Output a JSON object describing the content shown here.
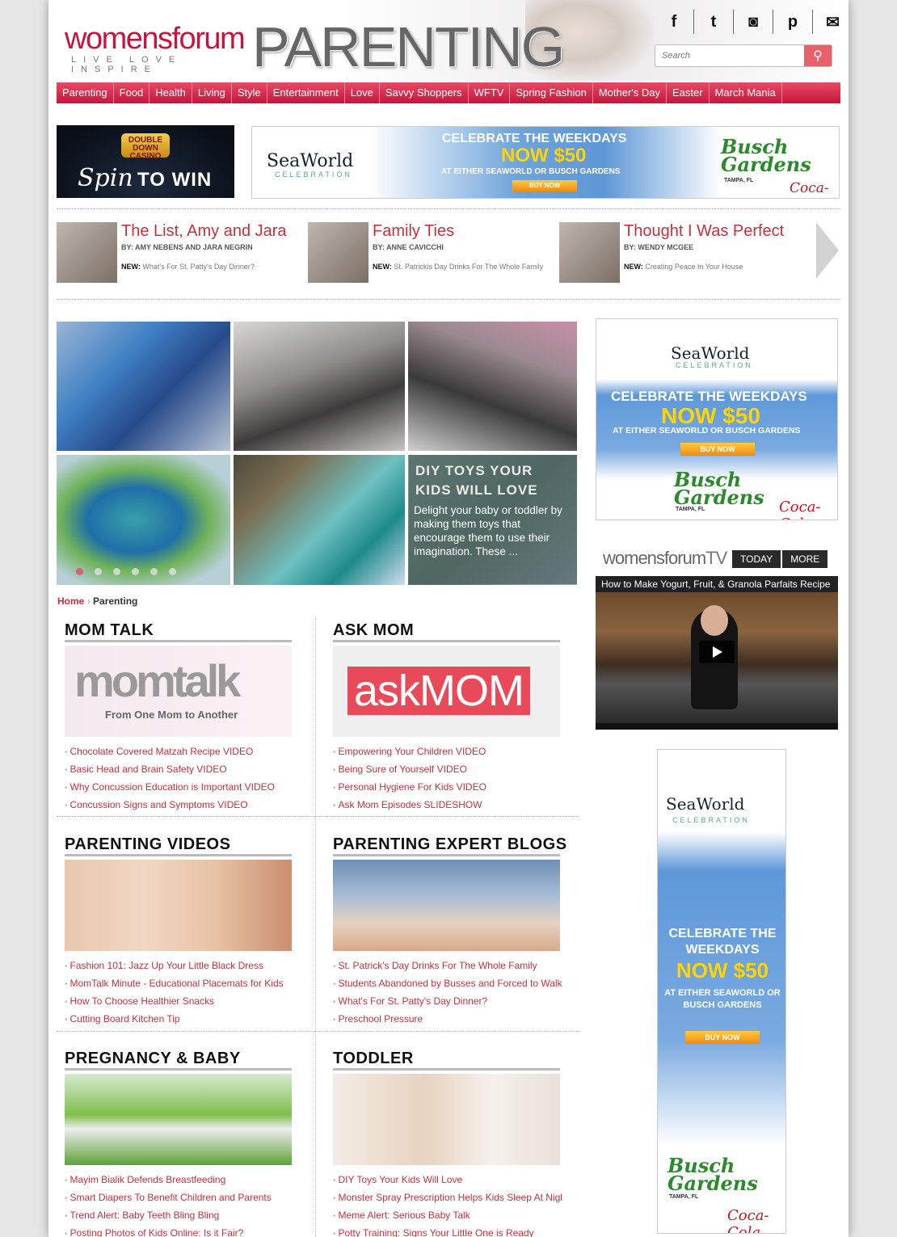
{
  "header": {
    "logo_main": "womensforum",
    "logo_tagline": "LIVE LOVE INSPIRE",
    "brand": "PARENTING",
    "social": [
      "f",
      "t",
      "◙",
      "p",
      "✉"
    ],
    "social_icons": [
      "facebook-icon",
      "twitter-icon",
      "instagram-icon",
      "pinterest-icon",
      "email-icon"
    ],
    "search_placeholder": "Search"
  },
  "nav": [
    "Parenting",
    "Food",
    "Health",
    "Living",
    "Style",
    "Entertainment",
    "Love",
    "Savvy Shoppers",
    "WFTV",
    "Spring Fashion",
    "Mother's Day",
    "Easter",
    "March Mania"
  ],
  "ads": {
    "spin": {
      "badge": "DOUBLE DOWN CASINO",
      "spin": "Spin",
      "towin": "TO WIN"
    },
    "seaworld": {
      "brand": "SeaWorld",
      "celebration": "CELEBRATION",
      "line1": "CELEBRATE THE WEEKDAYS",
      "line2": "NOW $50",
      "line3": "AT EITHER SEAWORLD OR BUSCH GARDENS",
      "buy": "BUY NOW",
      "busch": "Busch Gardens",
      "tampa": "TAMPA, FL",
      "coke": "Coca-Cola"
    }
  },
  "columnists": [
    {
      "title": "The List, Amy and Jara",
      "by": "BY: AMY NEBENS AND JARA NEGRIN",
      "new_label": "NEW:",
      "new_text": "What's For St. Patty's Day Dinner?"
    },
    {
      "title": "Family Ties",
      "by": "BY: ANNE CAVICCHI",
      "new_label": "NEW:",
      "new_text": "St. Patrickis Day Drinks For The Whole Family"
    },
    {
      "title": "Thought I Was Perfect",
      "by": "BY: WENDY MCGEE",
      "new_label": "NEW:",
      "new_text": "Creating Peace In Your House"
    }
  ],
  "slideshow": {
    "heading": "DIY TOYS YOUR KIDS WILL LOVE",
    "text": "Delight your baby or toddler by making them toys that encourage them to use their imagination. These ...",
    "active_dot": 0,
    "dot_count": 6
  },
  "breadcrumb": {
    "home": "Home",
    "sep": "›",
    "current": "Parenting"
  },
  "sections": [
    {
      "title": "MOM TALK",
      "img_text": "momtalk",
      "img_sub": "From One Mom to Another",
      "links": [
        "Chocolate Covered Matzah Recipe VIDEO",
        "Basic Head and Brain Safety VIDEO",
        "Why Concussion Education is Important VIDEO",
        "Concussion Signs and Symptoms VIDEO"
      ]
    },
    {
      "title": "ASK MOM",
      "img_text": "askMOM",
      "img_sub": "",
      "links": [
        "Empowering Your Children VIDEO",
        "Being Sure of Yourself VIDEO",
        "Personal Hygiene For Kids VIDEO",
        "Ask Mom Episodes SLIDESHOW"
      ]
    },
    {
      "title": "PARENTING VIDEOS",
      "img_text": "",
      "img_sub": "",
      "links": [
        "Fashion 101: Jazz Up Your Little Black Dress",
        "MomTalk Minute - Educational Placemats for Kids",
        "How To Choose Healthier Snacks",
        "Cutting Board Kitchen Tip"
      ]
    },
    {
      "title": "PARENTING EXPERT BLOGS",
      "img_text": "",
      "img_sub": "",
      "links": [
        "St. Patrick's Day Drinks For The Whole Family",
        "Students Abandoned by Busses and Forced to Walk",
        "What's For St. Patty's Day Dinner?",
        "Preschool Pressure"
      ]
    },
    {
      "title": "PREGNANCY & BABY",
      "img_text": "",
      "img_sub": "",
      "links": [
        "Mayim Bialik Defends Breastfeeding",
        "Smart Diapers To Benefit Children and Parents",
        "Trend Alert: Baby Teeth Bling Bling",
        "Posting Photos of Kids Online: Is it Fair?"
      ]
    },
    {
      "title": "TODDLER",
      "img_text": "",
      "img_sub": "",
      "links": [
        "DIY Toys Your Kids Will Love",
        "Monster Spray Prescription Helps Kids Sleep At Nigl",
        "Meme Alert: Serious Baby Talk",
        "Potty Training: Signs Your Little One is Ready"
      ]
    }
  ],
  "tv": {
    "logo": "womensforum",
    "logo_tv": "TV",
    "tabs": [
      "TODAY",
      "MORE"
    ],
    "video_title": "How to Make Yogurt, Fruit, & Granola Parfaits Recipe"
  },
  "colors": {
    "accent": "#c8143c",
    "link": "#c8303a",
    "nav_top": "#e84a62"
  }
}
